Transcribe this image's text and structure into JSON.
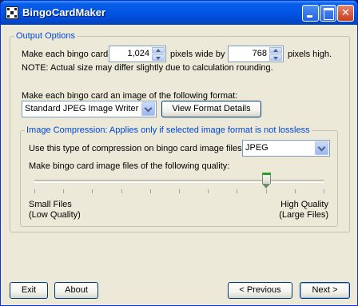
{
  "window": {
    "title": "BingoCardMaker"
  },
  "output_options": {
    "legend": "Output Options",
    "size_prefix": "Make each bingo card",
    "width_value": "1,024",
    "width_suffix": "pixels wide by",
    "height_value": "768",
    "height_suffix": "pixels high.",
    "note": "NOTE: Actual size may differ slightly due to calculation rounding.",
    "format_label": "Make each bingo card an image of the following format:",
    "format_value": "Standard JPEG Image Writer",
    "view_details_label": "View Format Details"
  },
  "compression": {
    "legend": "Image Compression: Applies only if selected image format is not lossless",
    "type_label": "Use this type of compression on bingo card image files:",
    "type_value": "JPEG",
    "quality_label": "Make bingo card image files of the following quality:",
    "quality_level": 0.8,
    "low_line1": "Small Files",
    "low_line2": "(Low Quality)",
    "high_line1": "High Quality",
    "high_line2": "(Large Files)"
  },
  "buttons": {
    "exit": "Exit",
    "about": "About",
    "previous": "< Previous",
    "next": "Next >"
  },
  "colors": {
    "legend": "#0046d5",
    "titlebar": "#0055e5",
    "window": "#ece9d8"
  }
}
